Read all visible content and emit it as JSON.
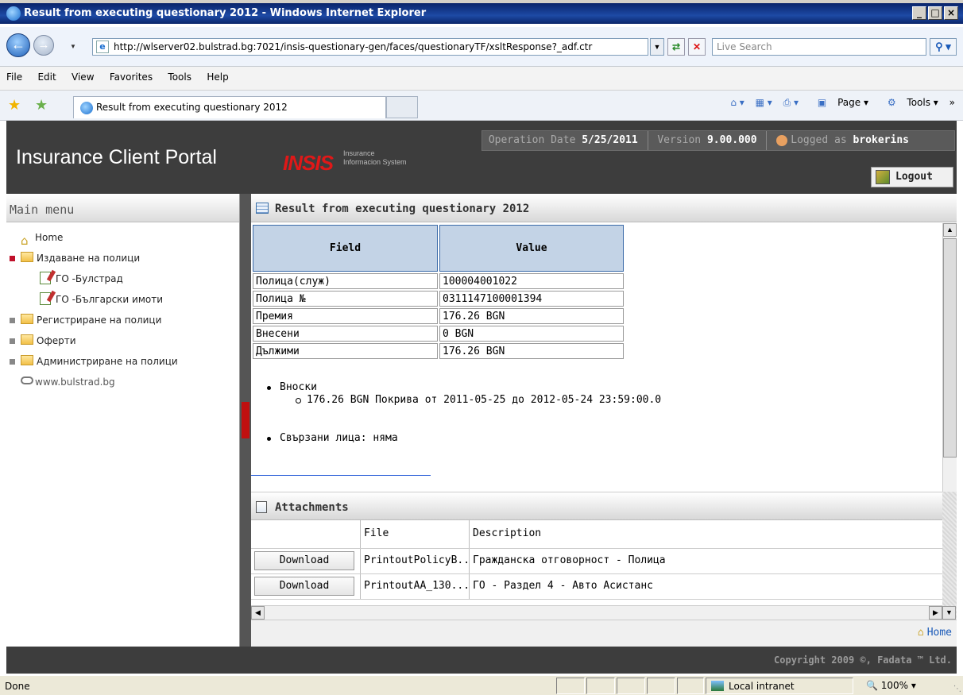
{
  "window": {
    "title": "Result from executing questionary 2012 - Windows Internet Explorer",
    "controls": [
      "_",
      "□",
      "×"
    ]
  },
  "browser": {
    "url": "http://wlserver02.bulstrad.bg:7021/insis-questionary-gen/faces/questionaryTF/xsltResponse?_adf.ctr",
    "search_placeholder": "Live Search",
    "menu": [
      "File",
      "Edit",
      "View",
      "Favorites",
      "Tools",
      "Help"
    ],
    "tab_title": "Result from executing questionary 2012",
    "commands": {
      "page": "Page",
      "tools": "Tools"
    }
  },
  "portal": {
    "title": "Insurance Client Portal",
    "logo_text": "INSIS",
    "logo_sub_1": "Insurance",
    "logo_sub_2": "Informacion System",
    "operation_date_label": "Operation Date",
    "operation_date": "5/25/2011",
    "version_label": "Version",
    "version": "9.00.000",
    "logged_label": "Logged as",
    "user": "brokerins",
    "logout": "Logout"
  },
  "sidebar": {
    "title": "Main menu",
    "items": [
      {
        "label": "Home"
      },
      {
        "label": "Издаване на полици"
      },
      {
        "label": "ГО -Булстрад"
      },
      {
        "label": "ГО -Български имоти"
      },
      {
        "label": "Регистриране на полици"
      },
      {
        "label": "Оферти"
      },
      {
        "label": "Администриране на полици"
      },
      {
        "label": "www.bulstrad.bg"
      }
    ]
  },
  "main": {
    "panel_title": "Result from executing questionary 2012",
    "table": {
      "headers": [
        "Field",
        "Value"
      ],
      "rows": [
        [
          "Полица(служ)",
          "100004001022"
        ],
        [
          "Полица №",
          "0311147100001394"
        ],
        [
          "Премия",
          "176.26 BGN"
        ],
        [
          "Внесени",
          "0 BGN"
        ],
        [
          "Дължими",
          "176.26 BGN"
        ]
      ]
    },
    "installments_label": "Вноски",
    "installment_1": "176.26 BGN Покрива от 2011-05-25 до 2012-05-24 23:59:00.0",
    "related_persons": "Свързани лица: няма",
    "attachments": {
      "title": "Attachments",
      "headers": [
        "",
        "File",
        "Description"
      ],
      "rows": [
        {
          "button": "Download",
          "file": "PrintoutPolicyB...",
          "description": "Гражданска отговорност - Полица"
        },
        {
          "button": "Download",
          "file": "PrintoutAA_130...",
          "description": "ГО - Раздел 4 - Авто Асистанс"
        }
      ]
    },
    "home_link": "Home"
  },
  "footer": {
    "copyright": "Copyright 2009 ©, Fadata ™ Ltd."
  },
  "status": {
    "text": "Done",
    "zone": "Local intranet",
    "zoom": "100%"
  }
}
